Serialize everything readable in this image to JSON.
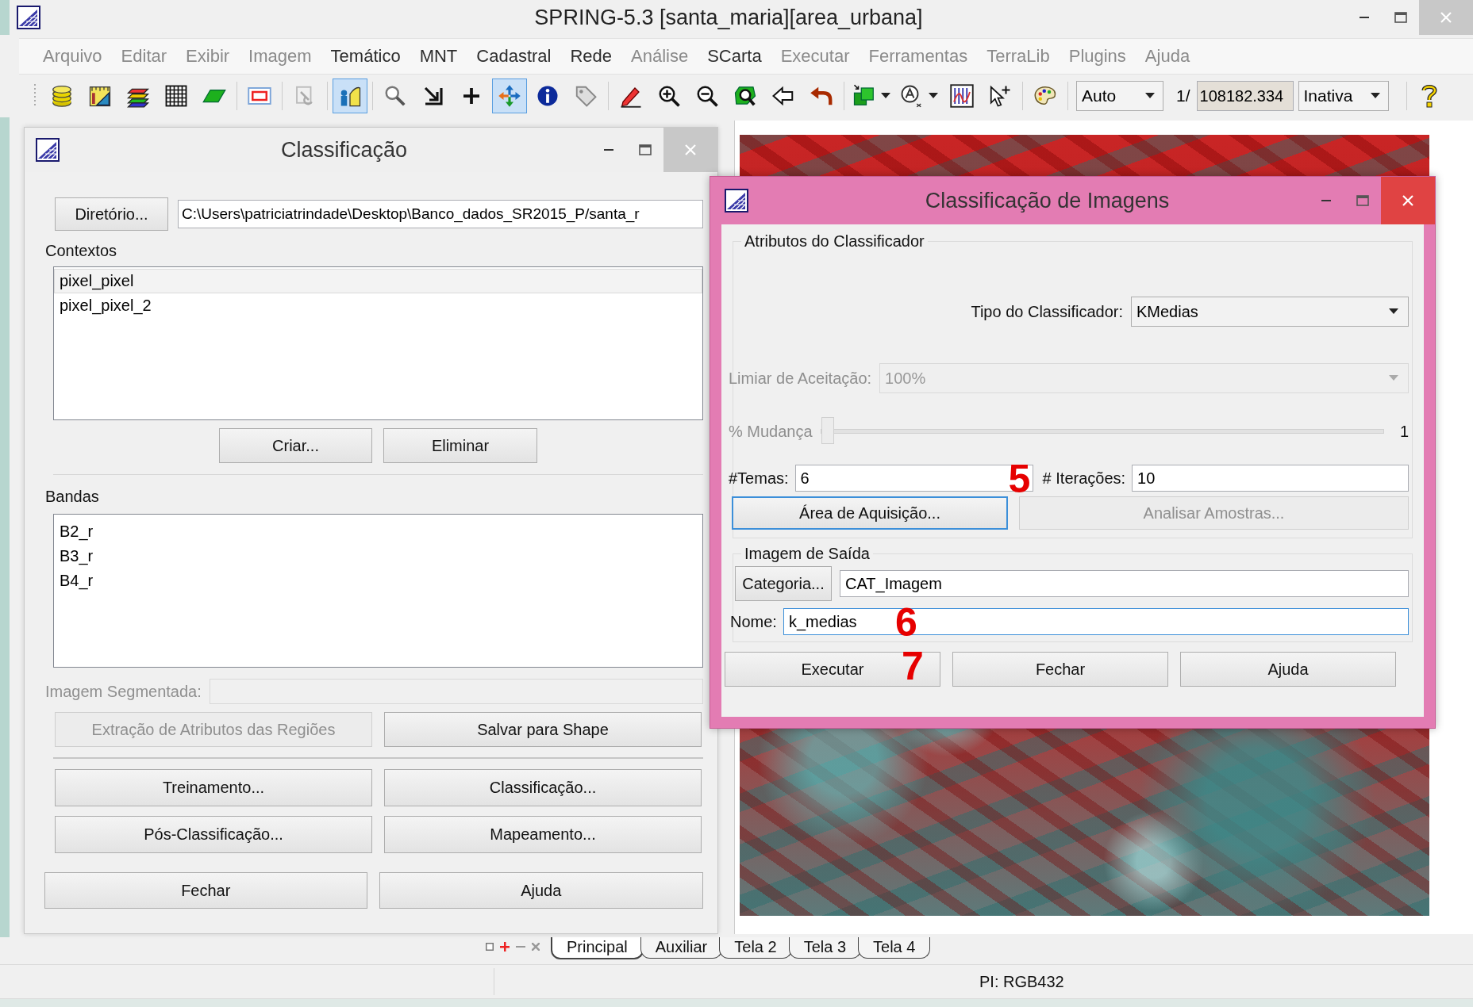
{
  "window": {
    "title": "SPRING-5.3 [santa_maria][area_urbana]"
  },
  "menu": [
    {
      "label": "Arquivo",
      "disabled": true
    },
    {
      "label": "Editar",
      "disabled": true
    },
    {
      "label": "Exibir",
      "disabled": true
    },
    {
      "label": "Imagem",
      "disabled": true
    },
    {
      "label": "Temático",
      "disabled": false
    },
    {
      "label": "MNT",
      "disabled": false
    },
    {
      "label": "Cadastral",
      "disabled": false
    },
    {
      "label": "Rede",
      "disabled": false
    },
    {
      "label": "Análise",
      "disabled": true
    },
    {
      "label": "SCarta",
      "disabled": false
    },
    {
      "label": "Executar",
      "disabled": true
    },
    {
      "label": "Ferramentas",
      "disabled": true
    },
    {
      "label": "TerraLib",
      "disabled": true
    },
    {
      "label": "Plugins",
      "disabled": true
    },
    {
      "label": "Ajuda",
      "disabled": true
    }
  ],
  "toolbar": {
    "tools": [
      {
        "kind": "database",
        "selected": false
      },
      {
        "kind": "ruler",
        "selected": false
      },
      {
        "kind": "layers",
        "selected": false
      },
      {
        "kind": "grid",
        "selected": false
      },
      {
        "kind": "parallelogram",
        "selected": false
      },
      {
        "kind": "separator"
      },
      {
        "kind": "frame",
        "selected": false
      },
      {
        "kind": "separator"
      },
      {
        "kind": "faded",
        "selected": false
      },
      {
        "kind": "separator"
      },
      {
        "kind": "figure",
        "selected": true
      },
      {
        "kind": "separator"
      },
      {
        "kind": "magnifier",
        "selected": false
      },
      {
        "kind": "corner",
        "selected": false
      },
      {
        "kind": "plus",
        "selected": false
      },
      {
        "kind": "move",
        "selected": true
      },
      {
        "kind": "info",
        "selected": false
      },
      {
        "kind": "tag",
        "selected": false
      },
      {
        "kind": "separator"
      },
      {
        "kind": "pencil",
        "selected": false
      },
      {
        "kind": "zoomin",
        "selected": false
      },
      {
        "kind": "zoomout",
        "selected": false
      },
      {
        "kind": "polyzoom",
        "selected": false
      },
      {
        "kind": "leftarrow",
        "selected": false
      },
      {
        "kind": "undo",
        "selected": false
      },
      {
        "kind": "separator"
      },
      {
        "kind": "squares",
        "selected": false,
        "dropdown": true
      },
      {
        "kind": "label",
        "selected": false,
        "dropdown": true
      },
      {
        "kind": "histogram",
        "selected": false
      },
      {
        "kind": "cursorplus",
        "selected": false
      },
      {
        "kind": "separator"
      },
      {
        "kind": "palette",
        "selected": false
      },
      {
        "kind": "separator"
      }
    ],
    "scale_mode": "Auto",
    "scale_prefix": "1/",
    "scale_value": "108182.334",
    "cursor_mode": "Inativa"
  },
  "classification_panel": {
    "title": "Classificação",
    "directory_button": "Diretório...",
    "directory_path": "C:\\Users\\patriciatrindade\\Desktop\\Banco_dados_SR2015_P/santa_r",
    "contexts_label": "Contextos",
    "contexts": [
      {
        "label": "pixel_pixel",
        "selected": true
      },
      {
        "label": "pixel_pixel_2",
        "selected": false
      }
    ],
    "create_button": "Criar...",
    "delete_button": "Eliminar",
    "bands_label": "Bandas",
    "bands": [
      "B2_r",
      "B3_r",
      "B4_r"
    ],
    "segmented_label": "Imagem Segmentada:",
    "region_buttons": [
      {
        "label": "Extração de Atributos das Regiões",
        "disabled": true
      },
      {
        "label": "Salvar para Shape",
        "disabled": false
      }
    ],
    "process_buttons": [
      "Treinamento...",
      "Classificação...",
      "Pós-Classificação...",
      "Mapeamento..."
    ],
    "footer_buttons": [
      "Fechar",
      "Ajuda"
    ]
  },
  "classifier_dialog": {
    "title": "Classificação de Imagens",
    "attributes_group": "Atributos do Classificador",
    "classifier": {
      "label": "Tipo do Classificador:",
      "value": "KMedias"
    },
    "threshold": {
      "label": "Limiar de Aceitação:",
      "value": "100%",
      "disabled": true
    },
    "change": {
      "label": "% Mudança",
      "level": 0,
      "reading": "1",
      "disabled": true
    },
    "themes": {
      "label": "#Temas:",
      "value": "6"
    },
    "iterations": {
      "label": "# Iterações:",
      "value": "10"
    },
    "acquisition_button": {
      "label": "Área de Aquisição...",
      "disabled": false
    },
    "analyze_button": {
      "label": "Analisar Amostras...",
      "disabled": true
    },
    "output_group": "Imagem de Saída",
    "category_button": "Categoria...",
    "category_value": "CAT_Imagem",
    "name": {
      "label": "Nome:",
      "value": "k_medias"
    },
    "buttons": [
      "Executar",
      "Fechar",
      "Ajuda"
    ],
    "annotations": [
      {
        "text": "5"
      },
      {
        "text": "6"
      },
      {
        "text": "7"
      }
    ]
  },
  "view_tabs": [
    {
      "label": "Principal",
      "selected": true
    },
    {
      "label": "Auxiliar",
      "selected": false
    },
    {
      "label": "Tela 2",
      "selected": false
    },
    {
      "label": "Tela 3",
      "selected": false
    },
    {
      "label": "Tela 4",
      "selected": false
    }
  ],
  "status_bar": {
    "text": "PI: RGB432"
  }
}
